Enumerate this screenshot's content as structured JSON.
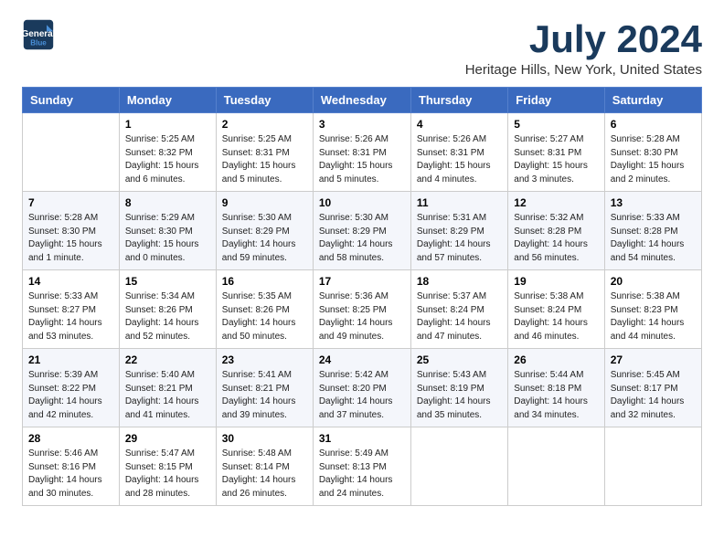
{
  "header": {
    "logo_line1": "General",
    "logo_line2": "Blue",
    "title": "July 2024",
    "subtitle": "Heritage Hills, New York, United States"
  },
  "columns": [
    "Sunday",
    "Monday",
    "Tuesday",
    "Wednesday",
    "Thursday",
    "Friday",
    "Saturday"
  ],
  "weeks": [
    [
      {
        "day": "",
        "info": ""
      },
      {
        "day": "1",
        "info": "Sunrise: 5:25 AM\nSunset: 8:32 PM\nDaylight: 15 hours\nand 6 minutes."
      },
      {
        "day": "2",
        "info": "Sunrise: 5:25 AM\nSunset: 8:31 PM\nDaylight: 15 hours\nand 5 minutes."
      },
      {
        "day": "3",
        "info": "Sunrise: 5:26 AM\nSunset: 8:31 PM\nDaylight: 15 hours\nand 5 minutes."
      },
      {
        "day": "4",
        "info": "Sunrise: 5:26 AM\nSunset: 8:31 PM\nDaylight: 15 hours\nand 4 minutes."
      },
      {
        "day": "5",
        "info": "Sunrise: 5:27 AM\nSunset: 8:31 PM\nDaylight: 15 hours\nand 3 minutes."
      },
      {
        "day": "6",
        "info": "Sunrise: 5:28 AM\nSunset: 8:30 PM\nDaylight: 15 hours\nand 2 minutes."
      }
    ],
    [
      {
        "day": "7",
        "info": "Sunrise: 5:28 AM\nSunset: 8:30 PM\nDaylight: 15 hours\nand 1 minute."
      },
      {
        "day": "8",
        "info": "Sunrise: 5:29 AM\nSunset: 8:30 PM\nDaylight: 15 hours\nand 0 minutes."
      },
      {
        "day": "9",
        "info": "Sunrise: 5:30 AM\nSunset: 8:29 PM\nDaylight: 14 hours\nand 59 minutes."
      },
      {
        "day": "10",
        "info": "Sunrise: 5:30 AM\nSunset: 8:29 PM\nDaylight: 14 hours\nand 58 minutes."
      },
      {
        "day": "11",
        "info": "Sunrise: 5:31 AM\nSunset: 8:29 PM\nDaylight: 14 hours\nand 57 minutes."
      },
      {
        "day": "12",
        "info": "Sunrise: 5:32 AM\nSunset: 8:28 PM\nDaylight: 14 hours\nand 56 minutes."
      },
      {
        "day": "13",
        "info": "Sunrise: 5:33 AM\nSunset: 8:28 PM\nDaylight: 14 hours\nand 54 minutes."
      }
    ],
    [
      {
        "day": "14",
        "info": "Sunrise: 5:33 AM\nSunset: 8:27 PM\nDaylight: 14 hours\nand 53 minutes."
      },
      {
        "day": "15",
        "info": "Sunrise: 5:34 AM\nSunset: 8:26 PM\nDaylight: 14 hours\nand 52 minutes."
      },
      {
        "day": "16",
        "info": "Sunrise: 5:35 AM\nSunset: 8:26 PM\nDaylight: 14 hours\nand 50 minutes."
      },
      {
        "day": "17",
        "info": "Sunrise: 5:36 AM\nSunset: 8:25 PM\nDaylight: 14 hours\nand 49 minutes."
      },
      {
        "day": "18",
        "info": "Sunrise: 5:37 AM\nSunset: 8:24 PM\nDaylight: 14 hours\nand 47 minutes."
      },
      {
        "day": "19",
        "info": "Sunrise: 5:38 AM\nSunset: 8:24 PM\nDaylight: 14 hours\nand 46 minutes."
      },
      {
        "day": "20",
        "info": "Sunrise: 5:38 AM\nSunset: 8:23 PM\nDaylight: 14 hours\nand 44 minutes."
      }
    ],
    [
      {
        "day": "21",
        "info": "Sunrise: 5:39 AM\nSunset: 8:22 PM\nDaylight: 14 hours\nand 42 minutes."
      },
      {
        "day": "22",
        "info": "Sunrise: 5:40 AM\nSunset: 8:21 PM\nDaylight: 14 hours\nand 41 minutes."
      },
      {
        "day": "23",
        "info": "Sunrise: 5:41 AM\nSunset: 8:21 PM\nDaylight: 14 hours\nand 39 minutes."
      },
      {
        "day": "24",
        "info": "Sunrise: 5:42 AM\nSunset: 8:20 PM\nDaylight: 14 hours\nand 37 minutes."
      },
      {
        "day": "25",
        "info": "Sunrise: 5:43 AM\nSunset: 8:19 PM\nDaylight: 14 hours\nand 35 minutes."
      },
      {
        "day": "26",
        "info": "Sunrise: 5:44 AM\nSunset: 8:18 PM\nDaylight: 14 hours\nand 34 minutes."
      },
      {
        "day": "27",
        "info": "Sunrise: 5:45 AM\nSunset: 8:17 PM\nDaylight: 14 hours\nand 32 minutes."
      }
    ],
    [
      {
        "day": "28",
        "info": "Sunrise: 5:46 AM\nSunset: 8:16 PM\nDaylight: 14 hours\nand 30 minutes."
      },
      {
        "day": "29",
        "info": "Sunrise: 5:47 AM\nSunset: 8:15 PM\nDaylight: 14 hours\nand 28 minutes."
      },
      {
        "day": "30",
        "info": "Sunrise: 5:48 AM\nSunset: 8:14 PM\nDaylight: 14 hours\nand 26 minutes."
      },
      {
        "day": "31",
        "info": "Sunrise: 5:49 AM\nSunset: 8:13 PM\nDaylight: 14 hours\nand 24 minutes."
      },
      {
        "day": "",
        "info": ""
      },
      {
        "day": "",
        "info": ""
      },
      {
        "day": "",
        "info": ""
      }
    ]
  ]
}
